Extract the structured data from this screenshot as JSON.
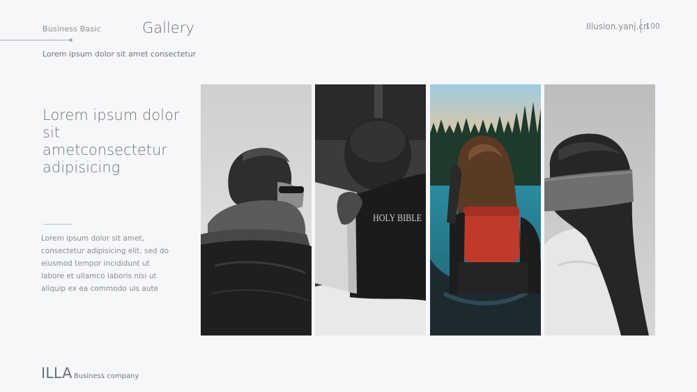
{
  "header": {
    "kicker": "Business Basic",
    "title": "Gallery",
    "subtitle": "Lorem ipsum dolor sit amet consectetur",
    "site": "Illusion.yanj.cn",
    "page_number": "100"
  },
  "main": {
    "headline": "Lorem ipsum dolor sit ametconsectetur adipisicing",
    "body": "Lorem ipsum dolor sit amet, consectetur adipisicing elit, sed do eiusmod tempor incididunt ut labore et ullamco laboris nisi ut aliquip ex ea commodo uis aute"
  },
  "gallery": {
    "photos": [
      {
        "icon": "person-scarf-sunglasses-photo"
      },
      {
        "icon": "child-reading-holy-bible-photo",
        "book_text": "HOLY BIBLE"
      },
      {
        "icon": "woman-in-canoe-photo"
      },
      {
        "icon": "blindfolded-woman-photo"
      }
    ]
  },
  "footer": {
    "brand": "ILLA",
    "brand_sub": "Business company"
  },
  "colors": {
    "background": "#f6f7f9",
    "text": "#6b6f75",
    "muted": "#878b91",
    "accent_red": "#c0392b",
    "water": "#2d8c9e"
  }
}
